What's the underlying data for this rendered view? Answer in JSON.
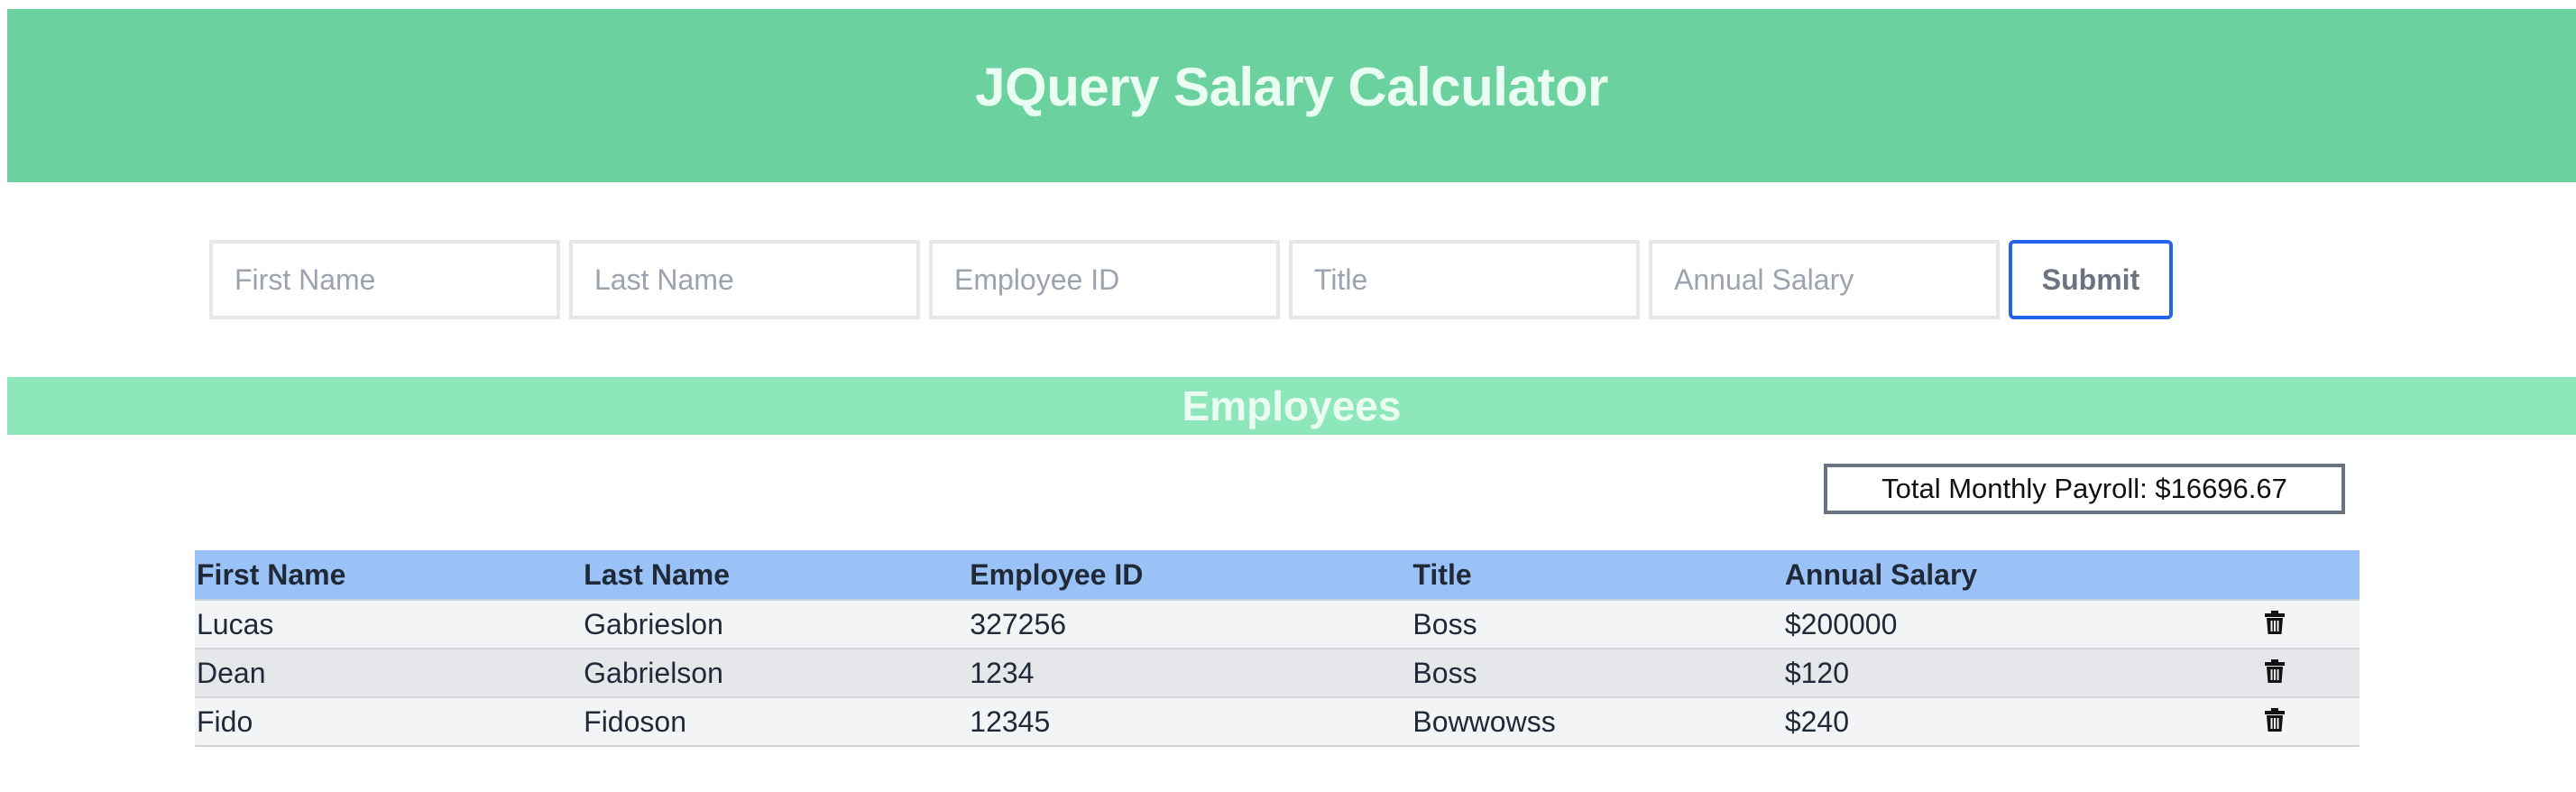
{
  "header": {
    "title": "JQuery Salary Calculator",
    "color": "#6ad19f"
  },
  "form": {
    "first_name_placeholder": "First Name",
    "last_name_placeholder": "Last Name",
    "employee_id_placeholder": "Employee ID",
    "title_placeholder": "Title",
    "annual_salary_placeholder": "Annual Salary",
    "submit_label": "Submit"
  },
  "employees_section": {
    "heading": "Employees",
    "color": "#8ee6bb"
  },
  "payroll": {
    "label": "Total Monthly Payroll: $16696.67"
  },
  "table": {
    "columns": [
      "First Name",
      "Last Name",
      "Employee ID",
      "Title",
      "Annual Salary"
    ],
    "rows": [
      {
        "first_name": "Lucas",
        "last_name": "Gabrieslon",
        "employee_id": "327256",
        "title": "Boss",
        "annual_salary": "$200000",
        "action_icon": "trash-icon"
      },
      {
        "first_name": "Dean",
        "last_name": "Gabrielson",
        "employee_id": "1234",
        "title": "Boss",
        "annual_salary": "$120",
        "action_icon": "trash-icon"
      },
      {
        "first_name": "Fido",
        "last_name": "Fidoson",
        "employee_id": "12345",
        "title": "Bowwowss",
        "annual_salary": "$240",
        "action_icon": "trash-icon"
      }
    ],
    "header_color": "#9bc2f6"
  }
}
